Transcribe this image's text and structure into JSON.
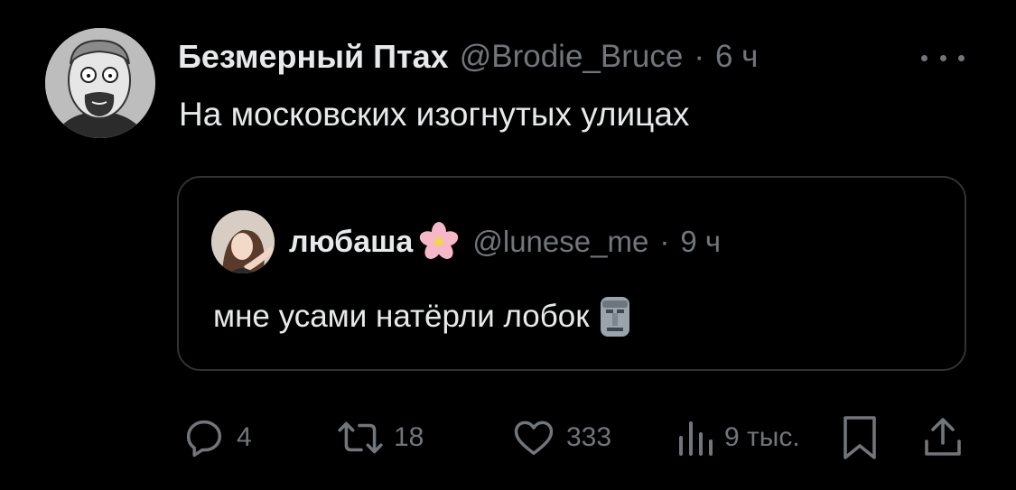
{
  "tweet": {
    "author_name": "Безмерный Птах",
    "author_handle": "@Brodie_Bruce",
    "time": "6 ч",
    "text": "На московских изогнутых улицах"
  },
  "quoted_tweet": {
    "author_name": "любаша",
    "author_handle": "@lunese_me",
    "time": "9 ч",
    "text": "мне усами натёрли лобок"
  },
  "actions": {
    "replies": "4",
    "reposts": "18",
    "likes": "333",
    "views": "9 тыс."
  },
  "icons": {
    "more": "more-dots-icon",
    "reply": "reply-icon",
    "repost": "repost-icon",
    "like": "heart-icon",
    "views": "views-chart-icon",
    "bookmark": "bookmark-icon",
    "share": "share-icon"
  },
  "colors": {
    "background": "#000000",
    "text_primary": "#e7e9ea",
    "text_secondary": "#71767b",
    "border": "#2f3336"
  }
}
